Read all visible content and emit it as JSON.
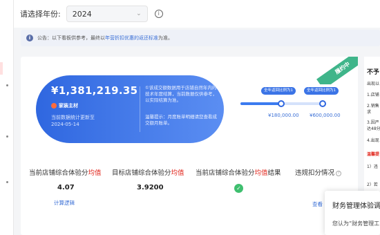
{
  "filter": {
    "label": "请选择年份:",
    "year": "2024"
  },
  "notice": {
    "icon": "info-icon",
    "prefix": "公告：以下看板供参考，最终以",
    "link": "年营折扣优惠的返还标准",
    "suffix": "为准。"
  },
  "gmv": {
    "amount": "¥1,381,219.35",
    "brand": "家装主材",
    "updated_label": "当前数据统计更新至",
    "updated_date": "2024-05-14",
    "note": "①该成交额数据用于店铺自然年内的技术年度结算，当前数据仅供参考，以实际结算为准。",
    "tip": "温馨提示：月度账单明细请您查看成交额月账单。"
  },
  "status_ribbon": "履约中",
  "progress": {
    "fill_fraction": 0.49,
    "pills": [
      "全年返回比例为1",
      "全年返回比例为1"
    ],
    "thresholds": [
      "¥180,000.00",
      "¥600,000.00"
    ]
  },
  "metrics": [
    {
      "label": "当前店铺综合体验分",
      "highlight": "均值",
      "value": "4.07",
      "link": "计算逻辑"
    },
    {
      "label": "目标店铺综合体验分",
      "highlight": "均值",
      "value": "3.9200"
    },
    {
      "label": "当前店铺综合体验分",
      "highlight": "均值",
      "suffix": "结果",
      "status": "达标"
    },
    {
      "label": "违规扣分情况",
      "link": "查看"
    }
  ],
  "right_panel": {
    "title": "不予",
    "lines": [
      "出现以",
      "1.店铺",
      "2.销售",
      "求",
      "3.因严",
      "达48分",
      "4.出现",
      "温馨提",
      "1）违",
      "2）若"
    ]
  },
  "popup": {
    "title": "财务管理体验调",
    "body": "您认为“财务管理工"
  }
}
